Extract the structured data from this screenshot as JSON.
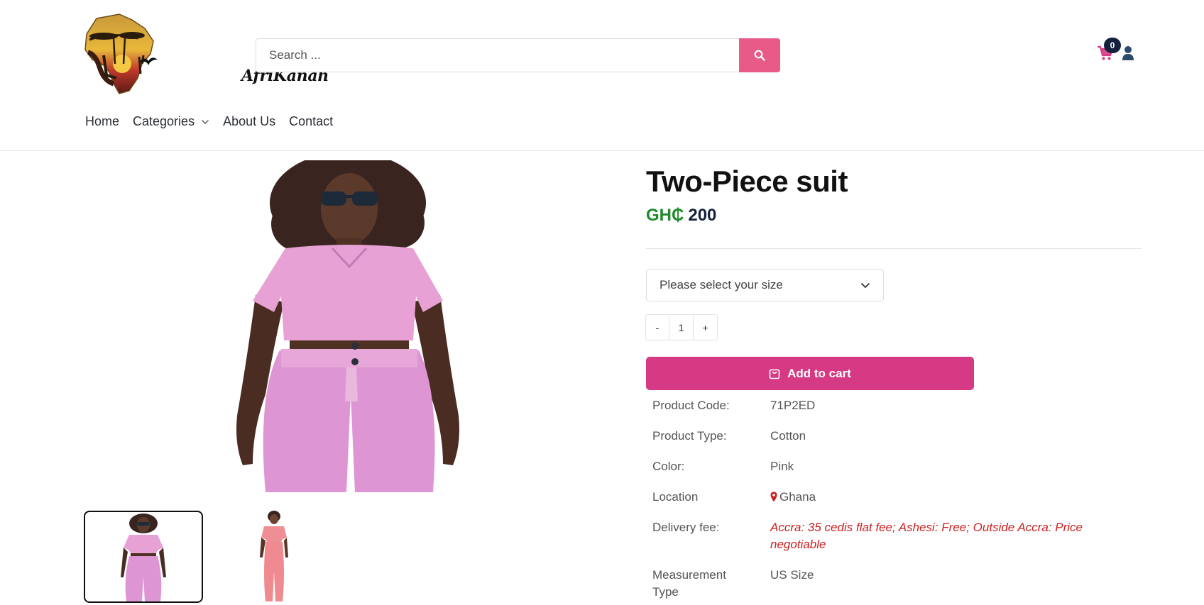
{
  "header": {
    "logo_text": "AfriKanah",
    "search": {
      "placeholder": "Search ..."
    },
    "cart_count": "0"
  },
  "nav": {
    "items": [
      {
        "label": "Home"
      },
      {
        "label": "Categories"
      },
      {
        "label": "About Us"
      },
      {
        "label": "Contact"
      }
    ]
  },
  "product": {
    "title": "Two-Piece suit",
    "currency": "GH₵",
    "price": "200",
    "size_placeholder": "Please select your size",
    "quantity": {
      "minus": "-",
      "value": "1",
      "plus": "+"
    },
    "add_to_cart": "Add to cart",
    "specs": [
      {
        "key": "Product Code:",
        "value": "71P2ED"
      },
      {
        "key": "Product Type:",
        "value": "Cotton"
      },
      {
        "key": "Color:",
        "value": "Pink"
      },
      {
        "key": "Location",
        "value": "Ghana"
      },
      {
        "key": "Delivery fee:",
        "value": "Accra: 35 cedis flat fee; Ashesi: Free; Outside Accra: Price negotiable"
      },
      {
        "key": "Measurement Type",
        "value": "US Size"
      }
    ]
  },
  "colors": {
    "accent_pink": "#d63a84",
    "search_button": "#e85a87",
    "currency_green": "#1e8a2b",
    "navy": "#14213d",
    "delivery_red": "#cc1f1f"
  }
}
